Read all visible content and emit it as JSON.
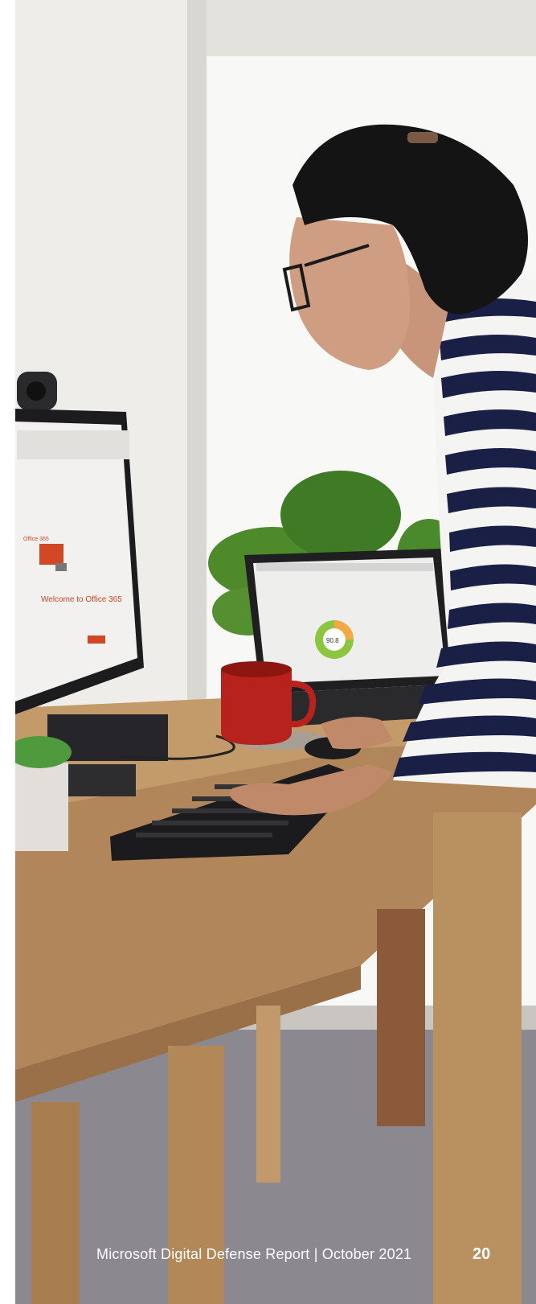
{
  "footer": {
    "report_title": "Microsoft Digital Defense Report  |  October 2021",
    "page_number": "20"
  },
  "monitor_screen": {
    "heading": "Welcome to Office 365",
    "brand": "Office 365"
  },
  "laptop_screen": {
    "donut_value": "90.8"
  }
}
